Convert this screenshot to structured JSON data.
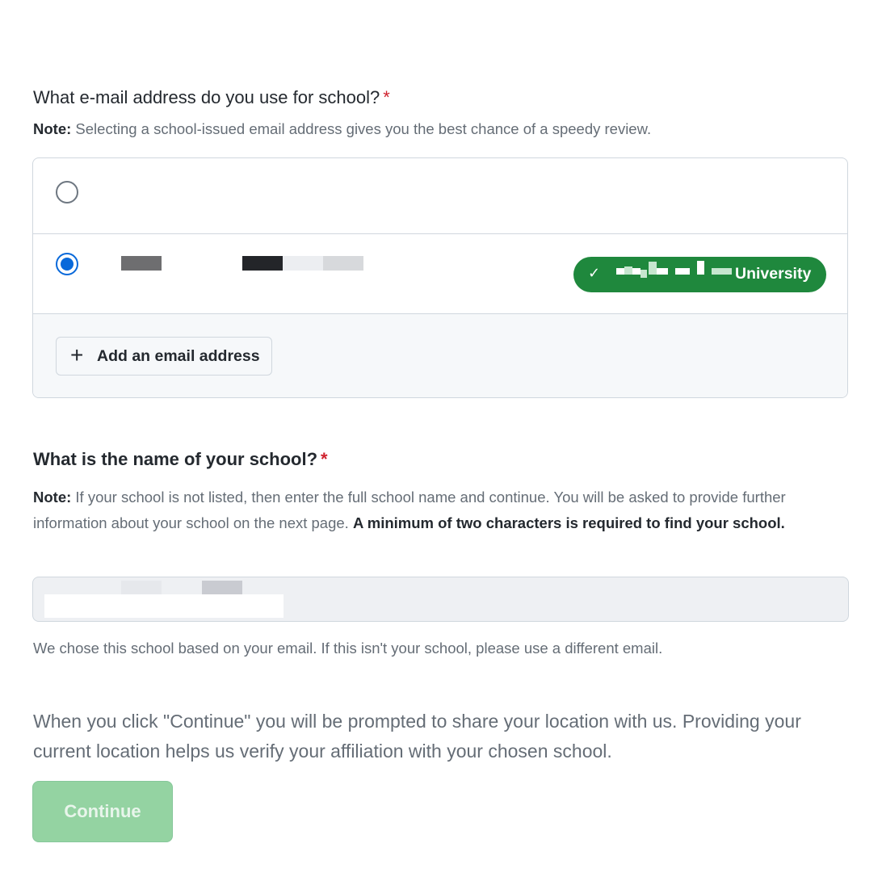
{
  "email_question": {
    "title": "What e-mail address do you use for school?",
    "required_mark": "*",
    "note_label": "Note:",
    "note_text": " Selecting a school-issued email address gives you the best chance of a speedy review."
  },
  "emails": {
    "options": [
      {
        "selected": false
      },
      {
        "selected": true,
        "badge_label": "University"
      }
    ],
    "add_button_label": "Add an email address"
  },
  "school_question": {
    "title": "What is the name of your school?",
    "required_mark": "*",
    "note_label": "Note:",
    "note_text": " If your school is not listed, then enter the full school name and continue. You will be asked to provide further information about your school on the next page. ",
    "note_bold": "A minimum of two characters is required to find your school."
  },
  "school_input": {
    "value": ""
  },
  "school_hint": "We chose this school based on your email. If this isn't your school, please use a different email.",
  "location_notice": "When you click \"Continue\" you will be prompted to share your location with us. Providing your current location helps us verify your affiliation with your chosen school.",
  "continue_label": "Continue",
  "colors": {
    "accent_blue": "#0969da",
    "badge_green": "#1f883d",
    "continue_disabled": "#94d3a2",
    "required_red": "#cf222e"
  }
}
